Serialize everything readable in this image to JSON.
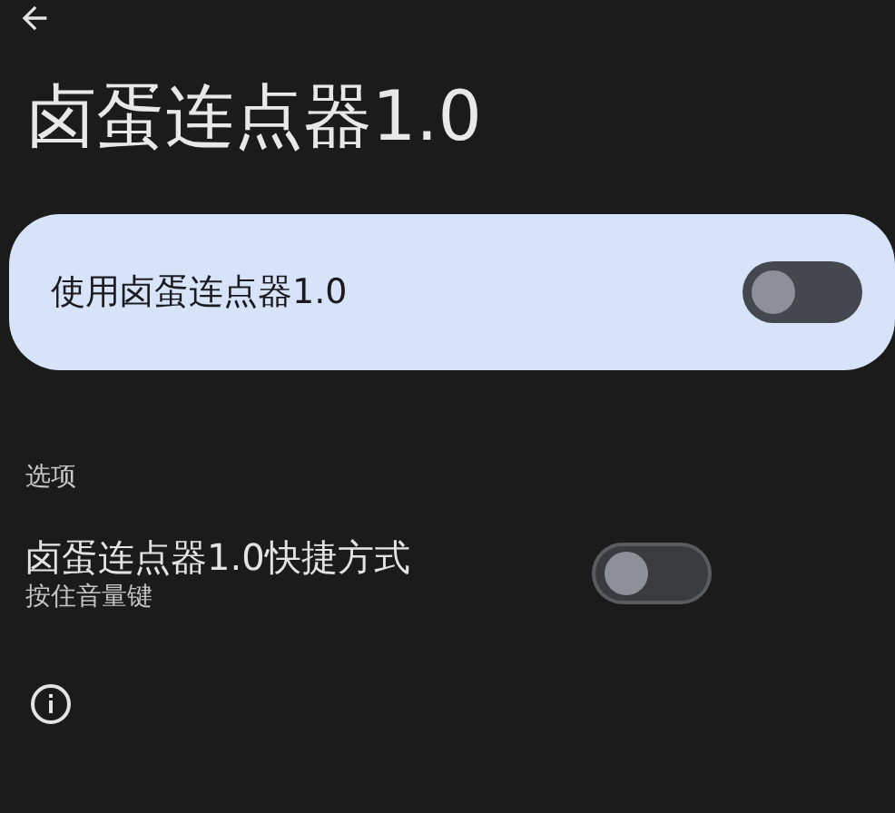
{
  "title": "卤蛋连点器1.0",
  "main_switch": {
    "label": "使用卤蛋连点器1.0",
    "on": false
  },
  "section_header": "选项",
  "options": [
    {
      "title": "卤蛋连点器1.0快捷方式",
      "subtitle": "按住音量键",
      "on": false
    }
  ]
}
